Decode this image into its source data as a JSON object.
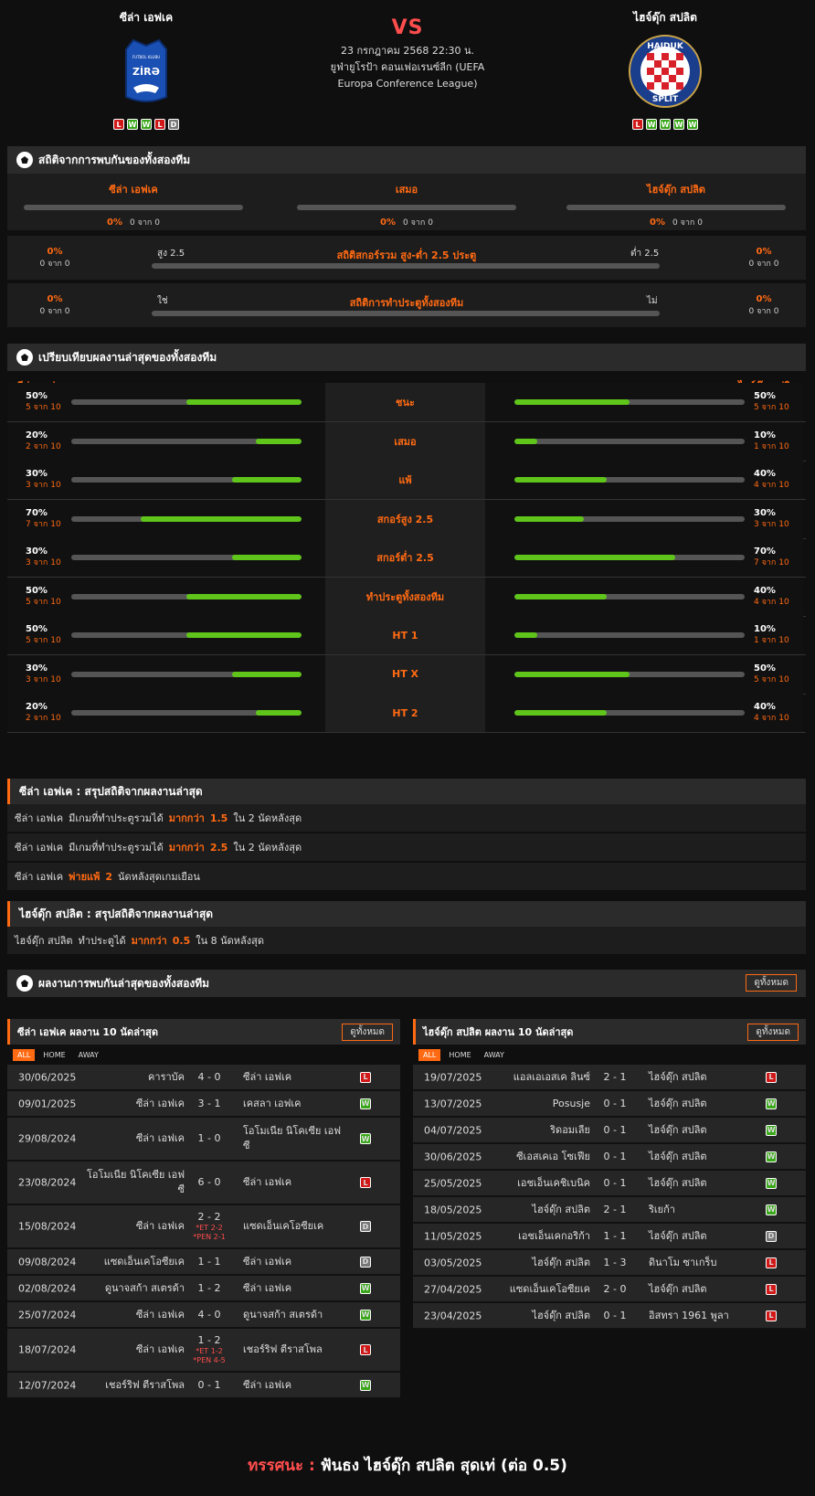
{
  "header": {
    "home_name": "ซีล่า เอฟเค",
    "away_name": "ไฮจ์ดุ๊ก สปลิต",
    "home_logo_text": "ZİRƏ",
    "home_logo_small": "FUTBOL KLUBU",
    "away_logo_top": "HAJDUK",
    "away_logo_bottom": "SPLIT",
    "vs": "VS",
    "date": "23 กรกฎาคม 2568 22:30 น.",
    "league": "ยูฟ่ายูโรป้า คอนเฟอเรนซ์ลีก (UEFA Europa Conference League)",
    "home_form": [
      "L",
      "W",
      "W",
      "L",
      "D"
    ],
    "away_form": [
      "L",
      "W",
      "W",
      "W",
      "W"
    ]
  },
  "h2h": {
    "title": "สถิติจากการพบกันของทั้งสองทีม",
    "cols": [
      {
        "name": "ซีล่า เอฟเค",
        "pct": "0%",
        "sub": "0 จาก 0"
      },
      {
        "name": "เสมอ",
        "pct": "0%",
        "sub": "0 จาก 0"
      },
      {
        "name": "ไฮจ์ดุ๊ก สปลิต",
        "pct": "0%",
        "sub": "0 จาก 0"
      }
    ],
    "ou": {
      "title": "สถิติสกอร์รวม สูง-ต่ำ 2.5 ประตู",
      "left_label": "สูง 2.5",
      "right_label": "ต่ำ 2.5",
      "left_pct": "0%",
      "left_sub": "0 จาก 0",
      "right_pct": "0%",
      "right_sub": "0 จาก 0"
    },
    "btts": {
      "title": "สถิติการทำประตูทั้งสองทีม",
      "left_label": "ใช่",
      "right_label": "ไม่",
      "left_pct": "0%",
      "left_sub": "0 จาก 0",
      "right_pct": "0%",
      "right_sub": "0 จาก 0"
    }
  },
  "compare": {
    "title": "เปรียบเทียบผลงานล่าสุดของทั้งสองทีม",
    "home_name": "ซีล่า เอฟเค",
    "away_name": "ไฮจ์ดุ๊ก สปลิต",
    "rows": [
      {
        "label": "ชนะ",
        "hp": "50%",
        "hs": "5 จาก 10",
        "hv": 0.5,
        "ap": "50%",
        "as": "5 จาก 10",
        "av": 0.5
      },
      {
        "label": "เสมอ",
        "hp": "20%",
        "hs": "2 จาก 10",
        "hv": 0.2,
        "ap": "10%",
        "as": "1 จาก 10",
        "av": 0.1
      },
      {
        "label": "แพ้",
        "hp": "30%",
        "hs": "3 จาก 10",
        "hv": 0.3,
        "ap": "40%",
        "as": "4 จาก 10",
        "av": 0.4
      },
      {
        "label": "สกอร์สูง 2.5",
        "hp": "70%",
        "hs": "7 จาก 10",
        "hv": 0.7,
        "ap": "30%",
        "as": "3 จาก 10",
        "av": 0.3
      },
      {
        "label": "สกอร์ต่ำ 2.5",
        "hp": "30%",
        "hs": "3 จาก 10",
        "hv": 0.3,
        "ap": "70%",
        "as": "7 จาก 10",
        "av": 0.7
      },
      {
        "label": "ทำประตูทั้งสองทีม",
        "hp": "50%",
        "hs": "5 จาก 10",
        "hv": 0.5,
        "ap": "40%",
        "as": "4 จาก 10",
        "av": 0.4
      },
      {
        "label": "HT 1",
        "hp": "50%",
        "hs": "5 จาก 10",
        "hv": 0.5,
        "ap": "10%",
        "as": "1 จาก 10",
        "av": 0.1
      },
      {
        "label": "HT X",
        "hp": "30%",
        "hs": "3 จาก 10",
        "hv": 0.3,
        "ap": "50%",
        "as": "5 จาก 10",
        "av": 0.5
      },
      {
        "label": "HT 2",
        "hp": "20%",
        "hs": "2 จาก 10",
        "hv": 0.2,
        "ap": "40%",
        "as": "4 จาก 10",
        "av": 0.4
      }
    ]
  },
  "home_summary": {
    "title": "ซีล่า เอฟเค : สรุปสถิติจากผลงานล่าสุด",
    "rows": [
      [
        "ซีล่า เอฟเค",
        "มีเกมที่ทำประตูรวมได้",
        "มากกว่า",
        "1.5",
        "ใน 2 นัดหลังสุด"
      ],
      [
        "ซีล่า เอฟเค",
        "มีเกมที่ทำประตูรวมได้",
        "มากกว่า",
        "2.5",
        "ใน 2 นัดหลังสุด"
      ],
      [
        "ซีล่า เอฟเค",
        "",
        "พ่ายแพ้",
        "2",
        "นัดหลังสุดเกมเยือน"
      ]
    ]
  },
  "away_summary": {
    "title": "ไฮจ์ดุ๊ก สปลิต : สรุปสถิติจากผลงานล่าสุด",
    "rows": [
      [
        "ไฮจ์ดุ๊ก สปลิต",
        "ทำประตูได้",
        "มากกว่า",
        "0.5",
        "ใน 8 นัดหลังสุด"
      ]
    ]
  },
  "recent": {
    "title": "ผลงานการพบกันล่าสุดของทั้งสองทีม",
    "view_all": "ดูทั้งหมด",
    "tabs": [
      "ALL",
      "HOME",
      "AWAY"
    ],
    "home": {
      "title": "ซีล่า เอฟเค ผลงาน 10 นัดล่าสุด",
      "matches": [
        {
          "date": "30/06/2025",
          "home": "คาราบัค",
          "score": "4 - 0",
          "note": "",
          "away": "ซีล่า เอฟเค",
          "res": "L",
          "tall": false
        },
        {
          "date": "09/01/2025",
          "home": "ซีล่า เอฟเค",
          "score": "3 - 1",
          "note": "",
          "away": "เคสลา เอฟเค",
          "res": "W",
          "tall": false
        },
        {
          "date": "29/08/2024",
          "home": "ซีล่า เอฟเค",
          "score": "1 - 0",
          "note": "",
          "away": "โอโมเนีย นิโคเซีย เอฟซี",
          "res": "W",
          "tall": true
        },
        {
          "date": "23/08/2024",
          "home": "โอโมเนีย นิโคเซีย เอฟซี",
          "score": "6 - 0",
          "note": "",
          "away": "ซีล่า เอฟเค",
          "res": "L",
          "tall": true
        },
        {
          "date": "15/08/2024",
          "home": "ซีล่า เอฟเค",
          "score": "2 - 2",
          "note": "*ET 2-2 *PEN 2-1",
          "away": "แซดเอ็นเคโอซียเค",
          "res": "D",
          "tall": true
        },
        {
          "date": "09/08/2024",
          "home": "แซดเอ็นเคโอซียเค",
          "score": "1 - 1",
          "note": "",
          "away": "ซีล่า เอฟเค",
          "res": "D",
          "tall": false
        },
        {
          "date": "02/08/2024",
          "home": "ดูนาจสก้า สเตรด้า",
          "score": "1 - 2",
          "note": "",
          "away": "ซีล่า เอฟเค",
          "res": "W",
          "tall": false
        },
        {
          "date": "25/07/2024",
          "home": "ซีล่า เอฟเค",
          "score": "4 - 0",
          "note": "",
          "away": "ดูนาจสก้า สเตรด้า",
          "res": "W",
          "tall": false
        },
        {
          "date": "18/07/2024",
          "home": "ซีล่า เอฟเค",
          "score": "1 - 2",
          "note": "*ET 1-2 *PEN 4-5",
          "away": "เชอร์ริฟ ตีราสโพล",
          "res": "L",
          "tall": true
        },
        {
          "date": "12/07/2024",
          "home": "เชอร์ริฟ ตีราสโพล",
          "score": "0 - 1",
          "note": "",
          "away": "ซีล่า เอฟเค",
          "res": "W",
          "tall": false
        }
      ]
    },
    "away": {
      "title": "ไฮจ์ดุ๊ก สปลิต ผลงาน 10 นัดล่าสุด",
      "matches": [
        {
          "date": "19/07/2025",
          "home": "แอลเอเอสเค ลินซ์",
          "score": "2 - 1",
          "note": "",
          "away": "ไฮจ์ดุ๊ก สปลิต",
          "res": "L",
          "tall": false
        },
        {
          "date": "13/07/2025",
          "home": "Posusje",
          "score": "0 - 1",
          "note": "",
          "away": "ไฮจ์ดุ๊ก สปลิต",
          "res": "W",
          "tall": false
        },
        {
          "date": "04/07/2025",
          "home": "ริดอมเลีย",
          "score": "0 - 1",
          "note": "",
          "away": "ไฮจ์ดุ๊ก สปลิต",
          "res": "W",
          "tall": false
        },
        {
          "date": "30/06/2025",
          "home": "ซีเอสเคเอ โซเฟีย",
          "score": "0 - 1",
          "note": "",
          "away": "ไฮจ์ดุ๊ก สปลิต",
          "res": "W",
          "tall": false
        },
        {
          "date": "25/05/2025",
          "home": "เอชเอ็นเคชิเบนิค",
          "score": "0 - 1",
          "note": "",
          "away": "ไฮจ์ดุ๊ก สปลิต",
          "res": "W",
          "tall": false
        },
        {
          "date": "18/05/2025",
          "home": "ไฮจ์ดุ๊ก สปลิต",
          "score": "2 - 1",
          "note": "",
          "away": "ริเยก้า",
          "res": "W",
          "tall": false
        },
        {
          "date": "11/05/2025",
          "home": "เอชเอ็นเคกอริก้า",
          "score": "1 - 1",
          "note": "",
          "away": "ไฮจ์ดุ๊ก สปลิต",
          "res": "D",
          "tall": false
        },
        {
          "date": "03/05/2025",
          "home": "ไฮจ์ดุ๊ก สปลิต",
          "score": "1 - 3",
          "note": "",
          "away": "ดินาโม ซาเกร็บ",
          "res": "L",
          "tall": false
        },
        {
          "date": "27/04/2025",
          "home": "แซดเอ็นเคโอซียเค",
          "score": "2 - 0",
          "note": "",
          "away": "ไฮจ์ดุ๊ก สปลิต",
          "res": "L",
          "tall": false
        },
        {
          "date": "23/04/2025",
          "home": "ไฮจ์ดุ๊ก สปลิต",
          "score": "0 - 1",
          "note": "",
          "away": "อิสทรา 1961 พูลา",
          "res": "L",
          "tall": false
        }
      ]
    }
  },
  "verdict": {
    "label": "ทรรศนะ :",
    "text": "ฟันธง ไฮจ์ดุ๊ก สปลิต สุดเท่ (ต่อ 0.5)"
  }
}
